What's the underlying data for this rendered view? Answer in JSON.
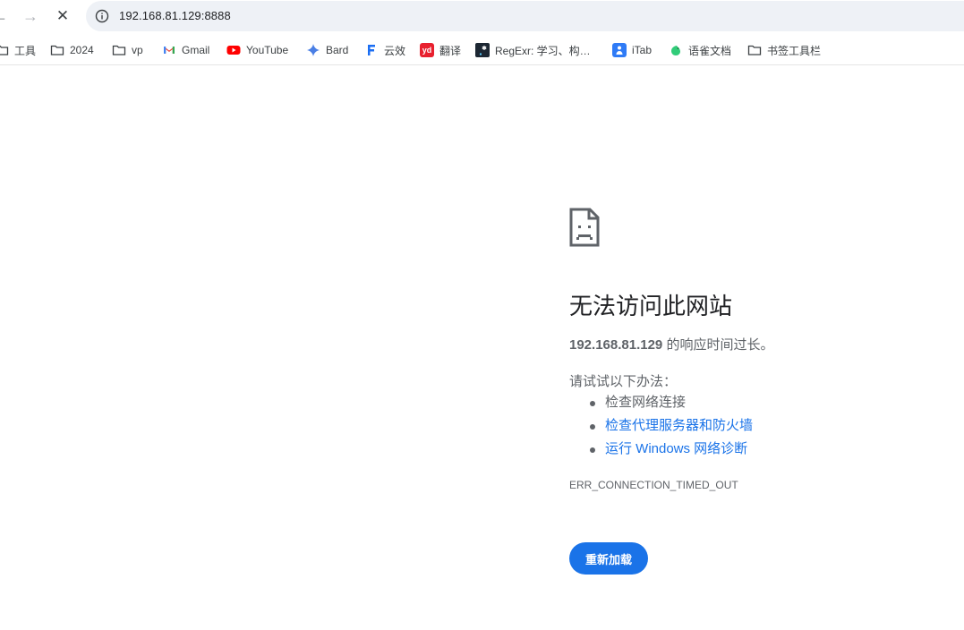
{
  "address_bar": {
    "url": "192.168.81.129:8888"
  },
  "nav": {
    "back": "←",
    "forward": "→",
    "stop": "✕"
  },
  "bookmarks": [
    {
      "label": "工具",
      "icon": "folder-icon"
    },
    {
      "label": "2024",
      "icon": "folder-icon"
    },
    {
      "label": "vp",
      "icon": "folder-icon"
    },
    {
      "label": "Gmail",
      "icon": "gmail-icon"
    },
    {
      "label": "YouTube",
      "icon": "youtube-icon"
    },
    {
      "label": "Bard",
      "icon": "bard-icon"
    },
    {
      "label": "云效",
      "icon": "yunxiao-icon"
    },
    {
      "label": "翻译",
      "icon": "youdao-icon",
      "icon_text": "yd"
    },
    {
      "label": "RegExr: 学习、构…",
      "icon": "regexr-icon"
    },
    {
      "label": "iTab",
      "icon": "itab-icon"
    },
    {
      "label": "语雀文档",
      "icon": "yuque-icon"
    },
    {
      "label": "书签工具栏",
      "icon": "folder-icon"
    }
  ],
  "error": {
    "title": "无法访问此网站",
    "host": "192.168.81.129",
    "host_suffix": " 的响应时间过长。",
    "try_label": "请试试以下办法：",
    "suggestions": [
      {
        "text": "检查网络连接",
        "link": false
      },
      {
        "text": "检查代理服务器和防火墙",
        "link": true
      },
      {
        "text": "运行 Windows 网络诊断",
        "link": true
      }
    ],
    "code": "ERR_CONNECTION_TIMED_OUT",
    "reload_label": "重新加载"
  },
  "colors": {
    "accent": "#1a73e8",
    "text": "#202124",
    "muted": "#5f6368",
    "omnibox_bg": "#eef1f6"
  }
}
